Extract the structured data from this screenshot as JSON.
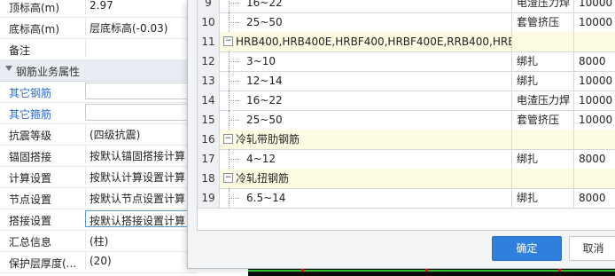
{
  "properties": {
    "rows": [
      {
        "label": "顶标高(m)",
        "value": "2.97",
        "style": "plain"
      },
      {
        "label": "底标高(m)",
        "value": "层底标高(-0.03)",
        "style": "plain"
      },
      {
        "label": "备注",
        "value": "",
        "style": "plain"
      }
    ],
    "section_title": "钢筋业务属性",
    "business_rows": [
      {
        "label": "其它钢筋",
        "value": "",
        "style": "link-boxed"
      },
      {
        "label": "其它箍筋",
        "value": "",
        "style": "link-boxed"
      },
      {
        "label": "抗震等级",
        "value": "(四级抗震)",
        "style": "plain"
      },
      {
        "label": "锚固搭接",
        "value": "按默认锚固搭接计算",
        "style": "plain"
      },
      {
        "label": "计算设置",
        "value": "按默认计算设置计算",
        "style": "plain"
      },
      {
        "label": "节点设置",
        "value": "按默认节点设置计算",
        "style": "plain"
      },
      {
        "label": "搭接设置",
        "value": "按默认搭接设置计算",
        "style": "active"
      },
      {
        "label": "汇总信息",
        "value": "(柱)",
        "style": "plain"
      },
      {
        "label": "保护层厚度(...",
        "value": "(20)",
        "style": "plain"
      }
    ]
  },
  "dialog": {
    "rows": [
      {
        "num": "9",
        "name": "16~22",
        "type": "电渣压力焊",
        "length": "10000",
        "kind": "child"
      },
      {
        "num": "10",
        "name": "25~50",
        "type": "套管挤压",
        "length": "10000",
        "kind": "child"
      },
      {
        "num": "11",
        "name": "HRB400,HRB400E,HRBF400,HRBF400E,RRB400,HRB...",
        "type": "",
        "length": "",
        "kind": "group"
      },
      {
        "num": "12",
        "name": "3~10",
        "type": "绑扎",
        "length": "8000",
        "kind": "child"
      },
      {
        "num": "13",
        "name": "12~14",
        "type": "绑扎",
        "length": "10000",
        "kind": "child"
      },
      {
        "num": "14",
        "name": "16~22",
        "type": "电渣压力焊",
        "length": "10000",
        "kind": "child"
      },
      {
        "num": "15",
        "name": "25~50",
        "type": "套管挤压",
        "length": "10000",
        "kind": "child"
      },
      {
        "num": "16",
        "name": "冷轧带肋钢筋",
        "type": "",
        "length": "",
        "kind": "group"
      },
      {
        "num": "17",
        "name": "4~12",
        "type": "绑扎",
        "length": "8000",
        "kind": "child"
      },
      {
        "num": "18",
        "name": "冷轧扭钢筋",
        "type": "",
        "length": "",
        "kind": "group"
      },
      {
        "num": "19",
        "name": "6.5~14",
        "type": "绑扎",
        "length": "8000",
        "kind": "child"
      }
    ],
    "collapse_symbol": "−",
    "ok_label": "确定",
    "cancel_label": "取消"
  },
  "colors": {
    "link": "#2b6ed6",
    "group_highlight": "#fdfbe2",
    "ok_button": "#2f7fdc"
  }
}
